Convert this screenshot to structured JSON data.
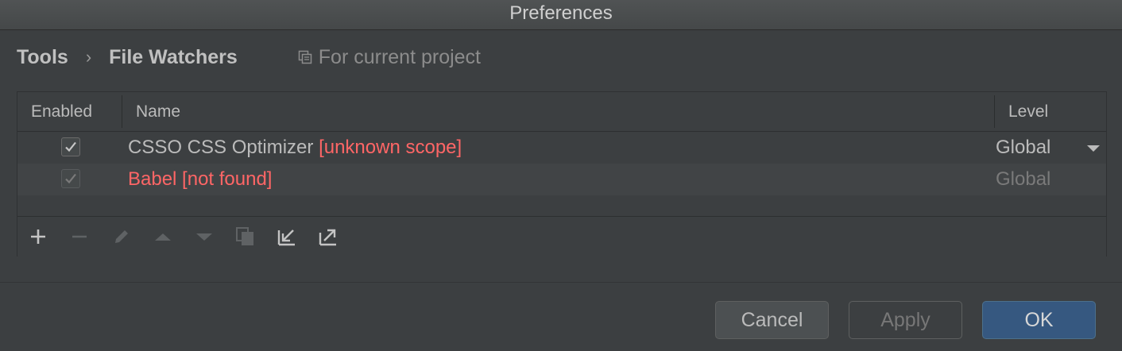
{
  "window": {
    "title": "Preferences"
  },
  "breadcrumb": {
    "items": [
      "Tools",
      "File Watchers"
    ],
    "separator": "›",
    "scope_label": "For current project"
  },
  "table": {
    "columns": [
      "Enabled",
      "Name",
      "Level"
    ],
    "rows": [
      {
        "enabled": true,
        "name": "CSSO CSS Optimizer",
        "error": "[unknown scope]",
        "level": "Global",
        "has_dropdown": true
      },
      {
        "enabled": true,
        "name": "",
        "error": "Babel [not found]",
        "level": "Global",
        "has_dropdown": false
      }
    ]
  },
  "toolbar": {
    "icons": [
      "add-icon",
      "remove-icon",
      "edit-icon",
      "move-up-icon",
      "move-down-icon",
      "copy-icon",
      "import-icon",
      "export-icon"
    ]
  },
  "buttons": {
    "cancel": "Cancel",
    "apply": "Apply",
    "ok": "OK"
  },
  "colors": {
    "background": "#3c3f41",
    "error_text": "#ff6666",
    "ok_button": "#365880"
  }
}
